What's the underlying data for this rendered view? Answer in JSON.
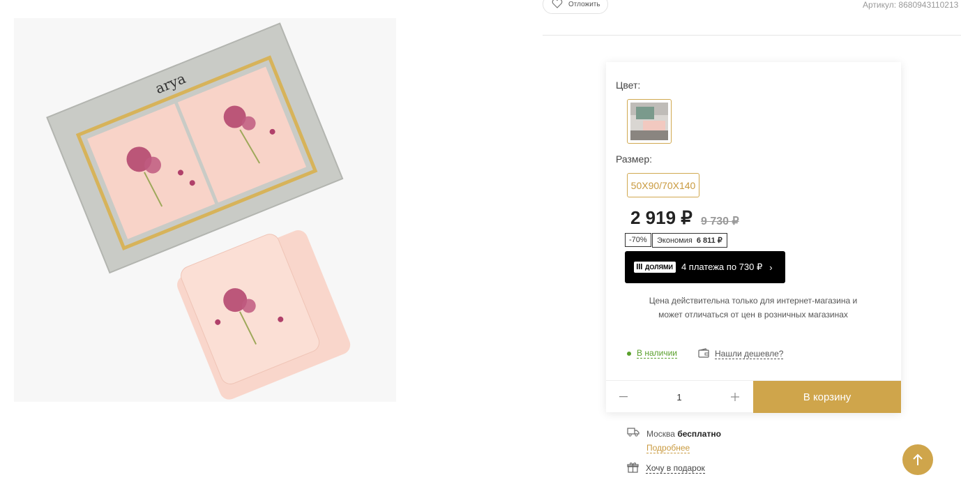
{
  "header": {
    "wishlist_label": "Отложить",
    "article_label": "Артикул:",
    "article_value": "8680943110213"
  },
  "product": {
    "brand_on_box": "arya",
    "color_label": "Цвет:",
    "size_label": "Размер:",
    "size_value": "50X90/70X140",
    "price": "2 919 ₽",
    "old_price": "9 730 ₽",
    "discount": "-70%",
    "savings_label": "Экономия",
    "savings_value": "6 811 ₽",
    "installment_logo": "ДОЛЯМИ",
    "installment_text": "4 платежа по 730 ₽",
    "price_note": "Цена действительна только для интернет-магазина и может отличаться от цен в розничных магазинах",
    "stock_status": "В наличии",
    "cheaper_link": "Нашли дешевле?",
    "quantity": "1",
    "cart_button": "В корзину"
  },
  "delivery": {
    "city": "Москва",
    "cost": "бесплатно",
    "more_link": "Подробнее",
    "gift_link": "Хочу в подарок"
  },
  "colors": {
    "accent": "#cfa54b",
    "in_stock": "#5aa02c"
  }
}
